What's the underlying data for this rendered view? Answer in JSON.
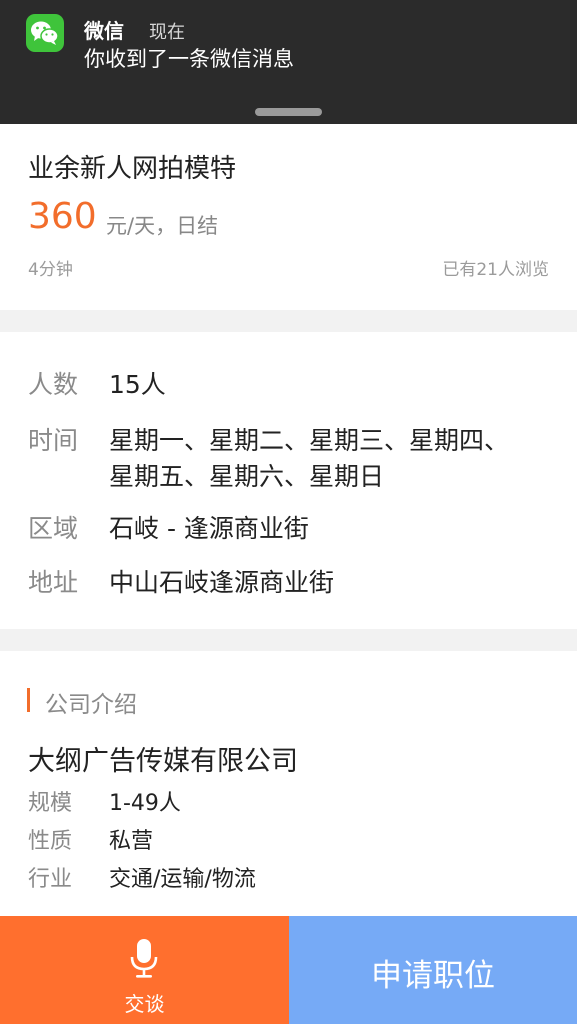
{
  "notification": {
    "app_name": "微信",
    "time": "现在",
    "message": "你收到了一条微信消息",
    "icon": "wechat-icon"
  },
  "job": {
    "title": "业余新人网拍模特",
    "salary_amount": "360",
    "salary_unit": "元/天，日结",
    "posted": "4分钟",
    "views": "已有21人浏览"
  },
  "details": {
    "headcount_label": "人数",
    "headcount_value": "15人",
    "time_label": "时间",
    "time_value": "星期一、星期二、星期三、星期四、星期五、星期六、星期日",
    "area_label": "区域",
    "area_value": "石岐 - 逢源商业街",
    "address_label": "地址",
    "address_value": "中山石岐逢源商业街"
  },
  "company": {
    "section_title": "公司介绍",
    "name": "大纲广告传媒有限公司",
    "size_label": "规模",
    "size_value": "1-49人",
    "type_label": "性质",
    "type_value": "私营",
    "industry_label": "行业",
    "industry_value": "交通/运输/物流"
  },
  "actions": {
    "chat_label": "交谈",
    "chat_icon": "microphone-icon",
    "apply_label": "申请职位"
  },
  "colors": {
    "accent": "#f26d2b",
    "chat_button": "#ff6f2e",
    "apply_button": "#76aaf6",
    "wechat_green": "#3fc43b"
  }
}
